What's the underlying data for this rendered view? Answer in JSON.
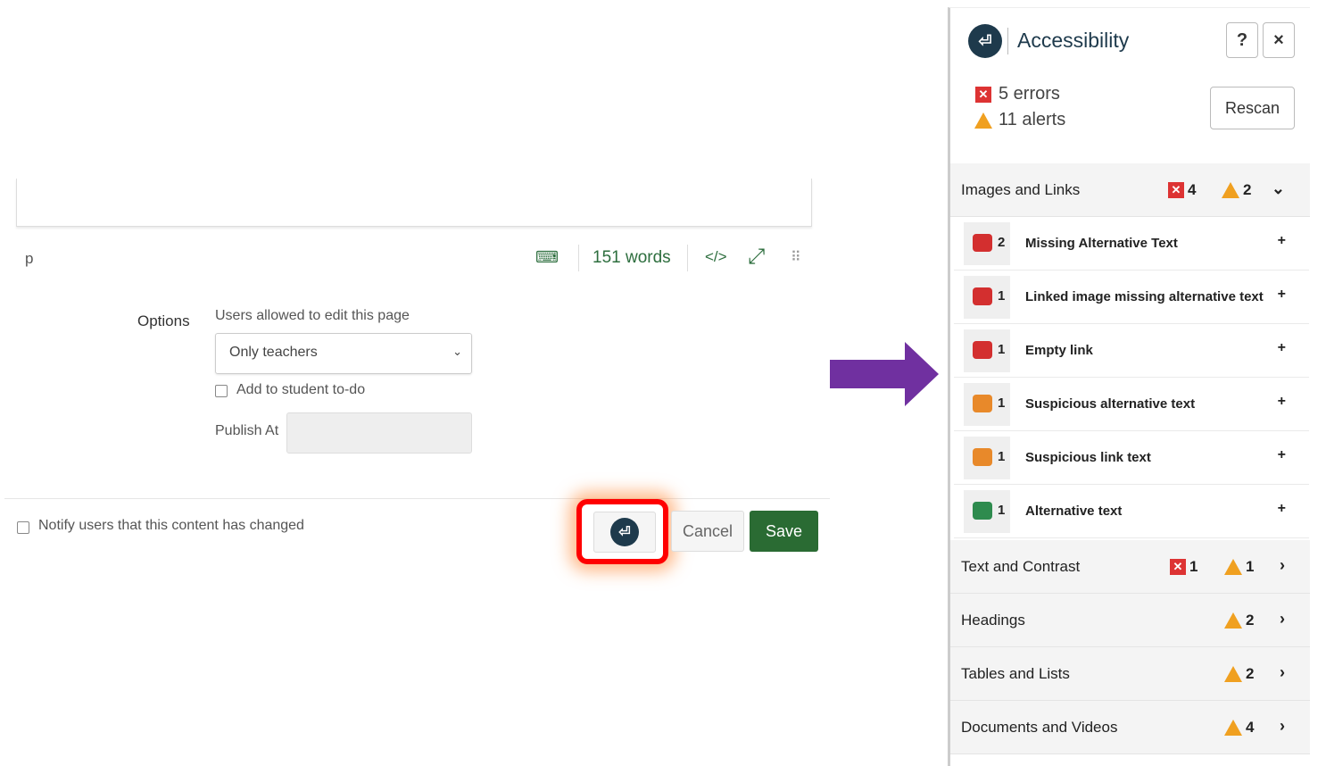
{
  "editor": {
    "path": "p",
    "word_count": "151 words",
    "html_toggle": "</>"
  },
  "options": {
    "label": "Options",
    "users_label": "Users allowed to edit this page",
    "users_value": "Only teachers",
    "todo_label": "Add to student to-do",
    "publish_label": "Publish At",
    "publish_value": ""
  },
  "footer": {
    "notify_label": "Notify users that this content has changed",
    "cancel": "Cancel",
    "save": "Save"
  },
  "colors": {
    "arrow": "#7030a0",
    "save": "#2a6b33",
    "error": "#d33333",
    "alert": "#f0a020",
    "highlight": "#ff0000"
  },
  "panel": {
    "title": "Accessibility",
    "help": "?",
    "close": "×",
    "errors": "5 errors",
    "alerts": "11 alerts",
    "rescan": "Rescan",
    "categories": [
      {
        "name": "Images and Links",
        "errors": "4",
        "alerts": "2",
        "expanded": true
      },
      {
        "name": "Text and Contrast",
        "errors": "1",
        "alerts": "1"
      },
      {
        "name": "Headings",
        "alerts": "2"
      },
      {
        "name": "Tables and Lists",
        "alerts": "2"
      },
      {
        "name": "Documents and Videos",
        "alerts": "4"
      }
    ],
    "items": [
      {
        "count": "2",
        "label": "Missing Alternative Text",
        "color": "#d32f2f"
      },
      {
        "count": "1",
        "label": "Linked image missing alternative text",
        "color": "#d32f2f"
      },
      {
        "count": "1",
        "label": "Empty link",
        "color": "#d32f2f"
      },
      {
        "count": "1",
        "label": "Suspicious alternative text",
        "color": "#e8892a"
      },
      {
        "count": "1",
        "label": "Suspicious link text",
        "color": "#e8892a"
      },
      {
        "count": "1",
        "label": "Alternative text",
        "color": "#2e8b4e"
      }
    ]
  }
}
